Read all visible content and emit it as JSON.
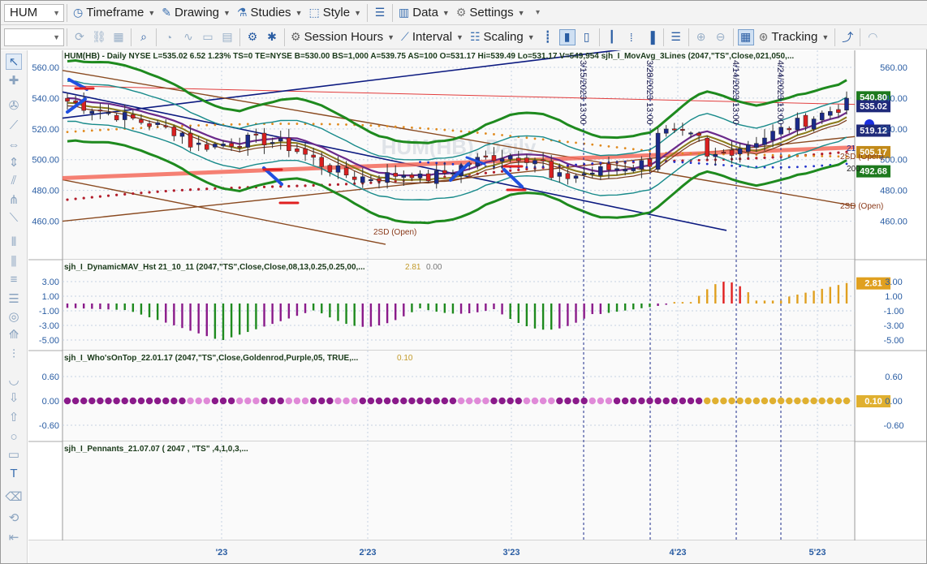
{
  "toolbar": {
    "symbol": "HUM",
    "timeframe": "Timeframe",
    "drawing": "Drawing",
    "studies": "Studies",
    "style": "Style",
    "data": "Data",
    "settings": "Settings",
    "session_hours": "Session Hours",
    "interval": "Interval",
    "scaling": "Scaling",
    "tracking": "Tracking"
  },
  "price_panel": {
    "header": "HUM(HB) - Daily  NYSE  L=535.02  6.52  1.23%  TS=0  TE=NYSE  B=530.00  BS=1,000  A=539.75  AS=100  O=531.17  Hi=539.49  Lo=531.17  V=549,954  sjh_I_MovAvg_3Lines (2047,\"TS\",Close,021,050,...",
    "watermark": "HUM(HB), Daily",
    "y_ticks": [
      "560.00",
      "540.00",
      "520.00",
      "500.00",
      "480.00",
      "460.00"
    ],
    "badges": [
      {
        "label": "540.80",
        "color": "#1e7a1e",
        "value": 540.8
      },
      {
        "label": "535.02",
        "color": "#1f2a7a",
        "value": 535.02
      },
      {
        "label": "519.12",
        "color": "#1f2a7a",
        "value": 519.12
      },
      {
        "label": "505.17",
        "color": "#c28a1a",
        "value": 505.17
      },
      {
        "label": "492.68",
        "color": "#1e7a1e",
        "value": 492.68
      }
    ],
    "annotations": [
      "2SD (Open)",
      "2SD (Open)",
      "2SD (Open)",
      "21",
      "200"
    ],
    "session_markers": [
      "3/15/2023 13:00",
      "3/28/2023 13:00",
      "4/14/2023 13:00",
      "4/24/2023 13:00"
    ]
  },
  "panel2": {
    "header": "sjh_I_DynamicMAV_Hst 21_10_11 (2047,\"TS\",Close,Close,08,13,0.25,0.25,00,...",
    "val1": "2.81",
    "val2": "0.00",
    "y_ticks": [
      "3.00",
      "1.00",
      "-1.00",
      "-3.00",
      "-5.00"
    ],
    "badge": "2.81"
  },
  "panel3": {
    "header": "sjh_I_Who'sOnTop_22.01.17 (2047,\"TS\",Close,Goldenrod,Purple,05, TRUE,...",
    "val": "0.10",
    "y_ticks": [
      "0.60",
      "0.00",
      "-0.60"
    ],
    "badge": "0.10"
  },
  "panel4": {
    "header": "sjh_I_Pennants_21.07.07 ( 2047 , \"TS\" ,4,1,0,3,..."
  },
  "x_axis": [
    "'23",
    "2'23",
    "3'23",
    "4'23",
    "5'23"
  ]
}
